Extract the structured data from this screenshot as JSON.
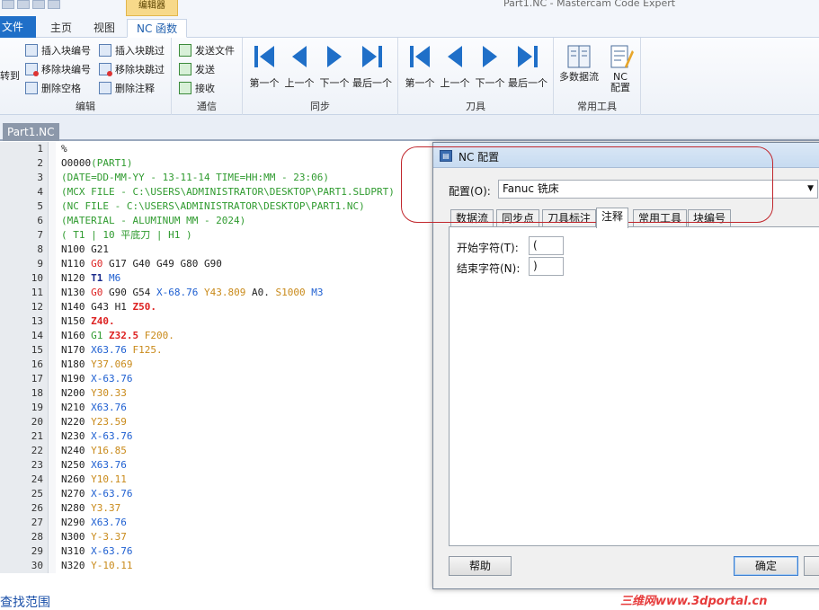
{
  "app": {
    "window_title": "Part1.NC - Mastercam Code Expert",
    "context_tab_title": "编辑器"
  },
  "ribbon_tabs": [
    {
      "label": "文件"
    },
    {
      "label": "主页"
    },
    {
      "label": "视图"
    },
    {
      "label": "NC 函数"
    }
  ],
  "ribbon": {
    "edit_group": {
      "label": "编辑",
      "truncated_button": "转到",
      "buttons": [
        "插入块编号",
        "插入块跳过",
        "移除块编号",
        "移除块跳过",
        "删除空格",
        "删除注释"
      ]
    },
    "comm_group": {
      "label": "通信",
      "buttons": [
        "发送文件",
        "发送",
        "接收"
      ]
    },
    "sync_group": {
      "label": "同步",
      "buttons": [
        "第一个",
        "上一个",
        "下一个",
        "最后一个"
      ]
    },
    "tool_group": {
      "label": "刀具",
      "buttons": [
        "第一个",
        "上一个",
        "下一个",
        "最后一个"
      ]
    },
    "common_group": {
      "label": "常用工具",
      "buttons": [
        "多数据流",
        "NC\n配置"
      ]
    }
  },
  "document": {
    "tab_label": "Part1.NC"
  },
  "code_lines": [
    {
      "n": "1",
      "tokens": [
        {
          "t": "%",
          "c": "pct"
        }
      ]
    },
    {
      "n": "2",
      "tokens": [
        {
          "t": "O0000",
          "c": "pn"
        },
        {
          "t": "(PART1)",
          "c": "cm"
        }
      ]
    },
    {
      "n": "3",
      "tokens": [
        {
          "t": "(DATE=DD-MM-YY - 13-11-14 TIME=HH:MM - 23:06)",
          "c": "cm"
        }
      ]
    },
    {
      "n": "4",
      "tokens": [
        {
          "t": "(MCX FILE - C:\\USERS\\ADMINISTRATOR\\DESKTOP\\PART1.SLDPRT)",
          "c": "cm"
        }
      ]
    },
    {
      "n": "5",
      "tokens": [
        {
          "t": "(NC FILE - C:\\USERS\\ADMINISTRATOR\\DESKTOP\\PART1.NC)",
          "c": "cm"
        }
      ]
    },
    {
      "n": "6",
      "tokens": [
        {
          "t": "(MATERIAL - ALUMINUM MM - 2024)",
          "c": "cm"
        }
      ]
    },
    {
      "n": "7",
      "tokens": [
        {
          "t": "( T1 | 10 平底刀 | H1 )",
          "c": "cm"
        }
      ]
    },
    {
      "n": "8",
      "tokens": [
        {
          "t": "N100 ",
          "c": "n"
        },
        {
          "t": "G21",
          "c": "g"
        }
      ]
    },
    {
      "n": "9",
      "tokens": [
        {
          "t": "N110 ",
          "c": "n"
        },
        {
          "t": "G0",
          "c": "g0"
        },
        {
          "t": " G17 G40 G49 G80 G90",
          "c": "g"
        }
      ]
    },
    {
      "n": "10",
      "tokens": [
        {
          "t": "N120 ",
          "c": "n"
        },
        {
          "t": "T1",
          "c": "t"
        },
        {
          "t": " ",
          "c": "g"
        },
        {
          "t": "M6",
          "c": "m"
        }
      ]
    },
    {
      "n": "11",
      "tokens": [
        {
          "t": "N130 ",
          "c": "n"
        },
        {
          "t": "G0",
          "c": "g0"
        },
        {
          "t": " G90 G54 ",
          "c": "g"
        },
        {
          "t": "X-68.76",
          "c": "x"
        },
        {
          "t": " ",
          "c": "g"
        },
        {
          "t": "Y43.809",
          "c": "y"
        },
        {
          "t": " A0. ",
          "c": "a"
        },
        {
          "t": "S1000",
          "c": "s"
        },
        {
          "t": " ",
          "c": "g"
        },
        {
          "t": "M3",
          "c": "m"
        }
      ]
    },
    {
      "n": "12",
      "tokens": [
        {
          "t": "N140 ",
          "c": "n"
        },
        {
          "t": "G43 H1 ",
          "c": "h"
        },
        {
          "t": "Z50.",
          "c": "z"
        }
      ]
    },
    {
      "n": "13",
      "tokens": [
        {
          "t": "N150 ",
          "c": "n"
        },
        {
          "t": "Z40.",
          "c": "z"
        }
      ]
    },
    {
      "n": "14",
      "tokens": [
        {
          "t": "N160 ",
          "c": "n"
        },
        {
          "t": "G1",
          "c": "g1"
        },
        {
          "t": " ",
          "c": "g"
        },
        {
          "t": "Z32.5",
          "c": "z"
        },
        {
          "t": " ",
          "c": "g"
        },
        {
          "t": "F200.",
          "c": "f"
        }
      ]
    },
    {
      "n": "15",
      "tokens": [
        {
          "t": "N170 ",
          "c": "n"
        },
        {
          "t": "X63.76",
          "c": "x"
        },
        {
          "t": " ",
          "c": "g"
        },
        {
          "t": "F125.",
          "c": "f"
        }
      ]
    },
    {
      "n": "16",
      "tokens": [
        {
          "t": "N180 ",
          "c": "n"
        },
        {
          "t": "Y37.069",
          "c": "y"
        }
      ]
    },
    {
      "n": "17",
      "tokens": [
        {
          "t": "N190 ",
          "c": "n"
        },
        {
          "t": "X-63.76",
          "c": "x"
        }
      ]
    },
    {
      "n": "18",
      "tokens": [
        {
          "t": "N200 ",
          "c": "n"
        },
        {
          "t": "Y30.33",
          "c": "y"
        }
      ]
    },
    {
      "n": "19",
      "tokens": [
        {
          "t": "N210 ",
          "c": "n"
        },
        {
          "t": "X63.76",
          "c": "x"
        }
      ]
    },
    {
      "n": "20",
      "tokens": [
        {
          "t": "N220 ",
          "c": "n"
        },
        {
          "t": "Y23.59",
          "c": "y"
        }
      ]
    },
    {
      "n": "21",
      "tokens": [
        {
          "t": "N230 ",
          "c": "n"
        },
        {
          "t": "X-63.76",
          "c": "x"
        }
      ]
    },
    {
      "n": "22",
      "tokens": [
        {
          "t": "N240 ",
          "c": "n"
        },
        {
          "t": "Y16.85",
          "c": "y"
        }
      ]
    },
    {
      "n": "23",
      "tokens": [
        {
          "t": "N250 ",
          "c": "n"
        },
        {
          "t": "X63.76",
          "c": "x"
        }
      ]
    },
    {
      "n": "24",
      "tokens": [
        {
          "t": "N260 ",
          "c": "n"
        },
        {
          "t": "Y10.11",
          "c": "y"
        }
      ]
    },
    {
      "n": "25",
      "tokens": [
        {
          "t": "N270 ",
          "c": "n"
        },
        {
          "t": "X-63.76",
          "c": "x"
        }
      ]
    },
    {
      "n": "26",
      "tokens": [
        {
          "t": "N280 ",
          "c": "n"
        },
        {
          "t": "Y3.37",
          "c": "y"
        }
      ]
    },
    {
      "n": "27",
      "tokens": [
        {
          "t": "N290 ",
          "c": "n"
        },
        {
          "t": "X63.76",
          "c": "x"
        }
      ]
    },
    {
      "n": "28",
      "tokens": [
        {
          "t": "N300 ",
          "c": "n"
        },
        {
          "t": "Y-3.37",
          "c": "y"
        }
      ]
    },
    {
      "n": "29",
      "tokens": [
        {
          "t": "N310 ",
          "c": "n"
        },
        {
          "t": "X-63.76",
          "c": "x"
        }
      ]
    },
    {
      "n": "30",
      "tokens": [
        {
          "t": "N320 ",
          "c": "n"
        },
        {
          "t": "Y-10.11",
          "c": "y"
        }
      ]
    }
  ],
  "find_bar": {
    "link": "查找范围"
  },
  "dialog": {
    "title": "NC 配置",
    "config_label": "配置(O):",
    "config_value": "Fanuc 铣床",
    "tabs": [
      "数据流",
      "同步点",
      "刀具标注",
      "注释",
      "常用工具",
      "块编号"
    ],
    "active_tab": "注释",
    "fields": [
      {
        "label": "开始字符(T):",
        "value": "("
      },
      {
        "label": "结束字符(N):",
        "value": ")"
      }
    ],
    "buttons": {
      "help": "帮助",
      "ok": "确定"
    }
  },
  "colors": {
    "accent": "#1f6fc8",
    "annotation": "#c1272d",
    "comment_green": "#2f9b2f",
    "x_blue": "#1e5fd1",
    "y_orange": "#c98a1a",
    "z_red": "#d22222"
  },
  "watermark": "三维网www.3dportal.cn"
}
